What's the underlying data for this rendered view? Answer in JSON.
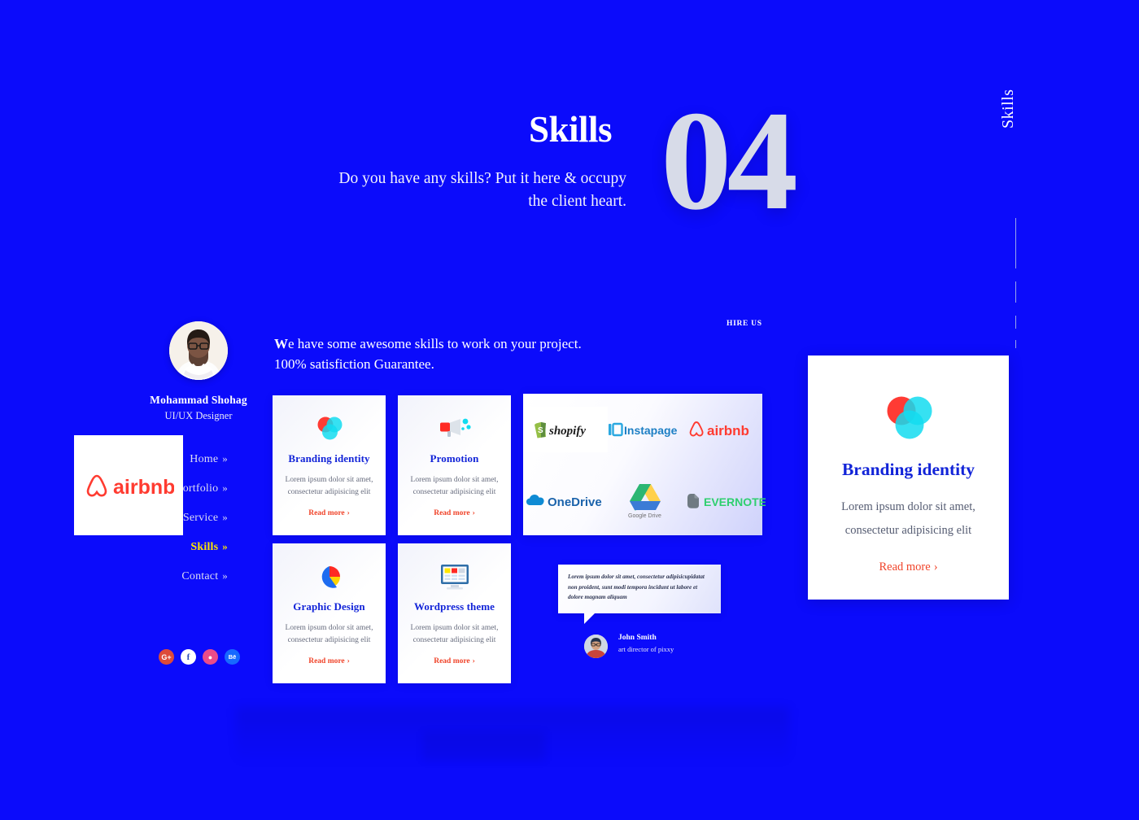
{
  "header": {
    "title": "Skills",
    "subtitle": "Do you have any skills? Put it here & occupy the client heart.",
    "section_number": "04",
    "vertical_label": "Skills"
  },
  "sidebar": {
    "profile_name": "Mohammad Shohag",
    "profile_role": "UI/UX Designer",
    "nav": [
      {
        "label": "Home",
        "chevron": "»",
        "active": false
      },
      {
        "label": "Portfolio",
        "chevron": "»",
        "active": false
      },
      {
        "label": "Service",
        "chevron": "»",
        "active": false
      },
      {
        "label": "Skills",
        "chevron": "»",
        "active": true
      },
      {
        "label": "Contact",
        "chevron": "»",
        "active": false
      }
    ],
    "socials": [
      {
        "name": "google-plus",
        "glyph": "G+"
      },
      {
        "name": "facebook",
        "glyph": "f"
      },
      {
        "name": "dribbble",
        "glyph": "●"
      },
      {
        "name": "behance",
        "glyph": "Bē"
      }
    ],
    "overlay_logo": "airbnb"
  },
  "intro": {
    "line1_lead": "W",
    "line1_rest": "e have some awesome skills to work on your project.",
    "line2": "100% satisfiction Guarantee.",
    "hire_us": "HIRE US"
  },
  "cards": [
    {
      "icon": "venn-circles-icon",
      "title": "Branding identity",
      "body": "Lorem ipsum dolor sit amet, consectetur adipisicing elit",
      "link": "Read more",
      "arrow": "›"
    },
    {
      "icon": "megaphone-icon",
      "title": "Promotion",
      "body": "Lorem ipsum dolor sit amet, consectetur adipisicing elit",
      "link": "Read more",
      "arrow": "›"
    },
    {
      "icon": "pie-chart-icon",
      "title": "Graphic Design",
      "body": "Lorem ipsum dolor sit amet, consectetur adipisicing elit",
      "link": "Read more",
      "arrow": "›"
    },
    {
      "icon": "monitor-icon",
      "title": "Wordpress theme",
      "body": "Lorem ipsum dolor sit amet, consectetur adipisicing elit",
      "link": "Read more",
      "arrow": "›"
    }
  ],
  "logos": [
    {
      "name": "shopify",
      "label": "shopify"
    },
    {
      "name": "instapage",
      "label": "Instapage"
    },
    {
      "name": "airbnb",
      "label": "airbnb"
    },
    {
      "name": "onedrive",
      "label": "OneDrive"
    },
    {
      "name": "google-drive",
      "label": "Google Drive"
    },
    {
      "name": "evernote",
      "label": "EVERNOTE"
    }
  ],
  "testimonial": {
    "quote": "Lorem ipsum dolor sit amet, consectetur adipisicupidatat non proident, sunt modi tempora incidunt ut labore et dolore magnam aliquam",
    "author": "John Smith",
    "author_role": "art director of pixxy"
  },
  "feature": {
    "icon": "venn-circles-icon",
    "title": "Branding identity",
    "body_line1": "Lorem ipsum dolor sit amet,",
    "body_line2": "consectetur adipisicing elit",
    "link": "Read more",
    "arrow": "›"
  },
  "colors": {
    "background": "#0b0bfb",
    "accent_red": "#f0442a",
    "title_blue": "#1224d8",
    "active_nav": "#ffe600",
    "number_grey": "#d7dbe8"
  }
}
